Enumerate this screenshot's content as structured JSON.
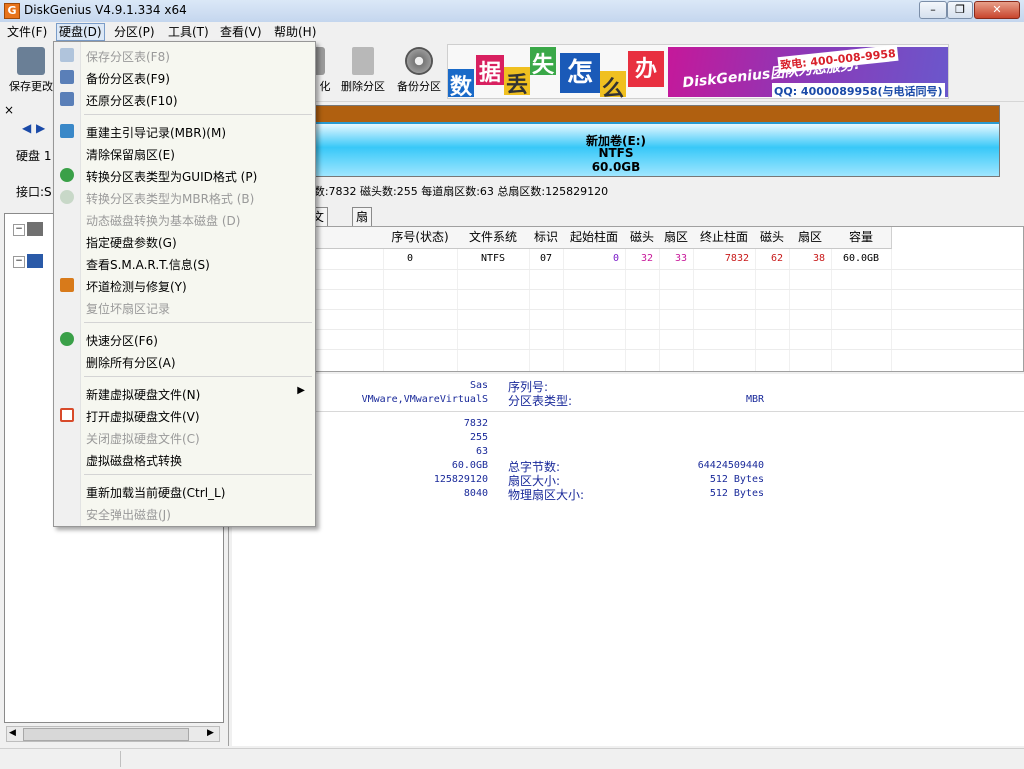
{
  "window": {
    "title": "DiskGenius V4.9.1.334 x64",
    "app_icon_letter": "G"
  },
  "menubar": [
    {
      "label": "文件(F)"
    },
    {
      "label": "硬盘(D)"
    },
    {
      "label": "分区(P)"
    },
    {
      "label": "工具(T)"
    },
    {
      "label": "查看(V)"
    },
    {
      "label": "帮助(H)"
    }
  ],
  "toolbar": {
    "buttons": [
      {
        "label": "保存更改",
        "icon": "save-icon",
        "color": "#6a7f96"
      },
      {
        "label": "化",
        "icon": "format-icon",
        "color": "#7a7a7a"
      },
      {
        "label": "删除分区",
        "icon": "trash-icon",
        "color": "#8a8a8a"
      },
      {
        "label": "备份分区",
        "icon": "backup-icon",
        "color": "#5a5a5a"
      }
    ],
    "banner": {
      "tiles": [
        "数",
        "据",
        "丢",
        "失",
        "怎",
        "么",
        "办"
      ],
      "slogan": "DiskGenius团队为您服务!",
      "phone": "致电: 400-008-9958",
      "qq": "QQ: 4000089958(与电话同号)"
    }
  },
  "left": {
    "disk_label": "硬盘 1",
    "interface_label": "接口:S",
    "close_glyph": "×"
  },
  "partition_bar": {
    "name": "新加卷(E:)",
    "fs": "NTFS",
    "size": "60.0GB"
  },
  "disk_info": "61440MB)  柱面数:7832  磁头数:255  每道扇区数:63  总扇区数:125829120",
  "tabs": [
    "文件",
    "扇区编辑"
  ],
  "table": {
    "headers": [
      "序号(状态)",
      "文件系统",
      "标识",
      "起始柱面",
      "磁头",
      "扇区",
      "终止柱面",
      "磁头",
      "扇区",
      "容量"
    ],
    "row": {
      "name_fragment": ":)",
      "index": "0",
      "fs": "NTFS",
      "id": "07",
      "start_cyl": "0",
      "start_head": "32",
      "start_sector": "33",
      "end_cyl": "7832",
      "end_head": "62",
      "end_sector": "38",
      "capacity": "60.0GB"
    }
  },
  "details": {
    "left_values": [
      "Sas",
      "VMware,VMwareVirtualS"
    ],
    "serial_label": "序列号:",
    "ptype_label": "分区表类型:",
    "ptype_value": "MBR",
    "geo_values": [
      "7832",
      "255",
      "63",
      "60.0GB",
      "125829120",
      "8040"
    ],
    "total_bytes_label": "总字节数:",
    "total_bytes": "64424509440",
    "sector_size_label": "扇区大小:",
    "sector_size": "512 Bytes",
    "phys_sector_label": "物理扇区大小:",
    "phys_sector": "512 Bytes"
  },
  "dropdown": {
    "items": [
      {
        "label": "保存分区表(F8)",
        "disabled": true,
        "icon": "save-table-icon",
        "color": "#b0c4dc"
      },
      {
        "label": "备份分区表(F9)",
        "disabled": false,
        "icon": "backup-table-icon",
        "color": "#5a7fb8"
      },
      {
        "label": "还原分区表(F10)",
        "disabled": false,
        "icon": "restore-table-icon",
        "color": "#5a7fb8"
      },
      {
        "label": "重建主引导记录(MBR)(M)",
        "disabled": false,
        "icon": "rebuild-mbr-icon",
        "color": "#3a88c8"
      },
      {
        "label": "清除保留扇区(E)",
        "disabled": false,
        "icon": "",
        "color": ""
      },
      {
        "label": "转换分区表类型为GUID格式 (P)",
        "disabled": false,
        "icon": "convert-guid-icon",
        "color": "#3aa048"
      },
      {
        "label": "转换分区表类型为MBR格式 (B)",
        "disabled": true,
        "icon": "convert-mbr-icon",
        "color": "#c8d8c8"
      },
      {
        "label": "动态磁盘转换为基本磁盘 (D)",
        "disabled": true,
        "icon": "",
        "color": ""
      },
      {
        "label": "指定硬盘参数(G)",
        "disabled": false,
        "icon": "",
        "color": ""
      },
      {
        "label": "查看S.M.A.R.T.信息(S)",
        "disabled": false,
        "icon": "",
        "color": ""
      },
      {
        "label": "坏道检测与修复(Y)",
        "disabled": false,
        "icon": "tools-icon",
        "color": "#d87a1a"
      },
      {
        "label": "复位坏扇区记录",
        "disabled": true,
        "icon": "",
        "color": ""
      },
      {
        "label": "快速分区(F6)",
        "disabled": false,
        "icon": "clock-icon",
        "color": "#3aa048"
      },
      {
        "label": "删除所有分区(A)",
        "disabled": false,
        "icon": "",
        "color": ""
      },
      {
        "label": "新建虚拟硬盘文件(N)",
        "disabled": false,
        "icon": "",
        "color": "",
        "submenu": true
      },
      {
        "label": "打开虚拟硬盘文件(V)",
        "disabled": false,
        "icon": "open-vdisk-icon",
        "color": "#d84a2a"
      },
      {
        "label": "关闭虚拟硬盘文件(C)",
        "disabled": true,
        "icon": "",
        "color": ""
      },
      {
        "label": "虚拟磁盘格式转换",
        "disabled": false,
        "icon": "",
        "color": ""
      },
      {
        "label": "重新加载当前硬盘(Ctrl_L)",
        "disabled": false,
        "icon": "",
        "color": ""
      },
      {
        "label": "安全弹出磁盘(J)",
        "disabled": true,
        "icon": "",
        "color": ""
      }
    ]
  }
}
